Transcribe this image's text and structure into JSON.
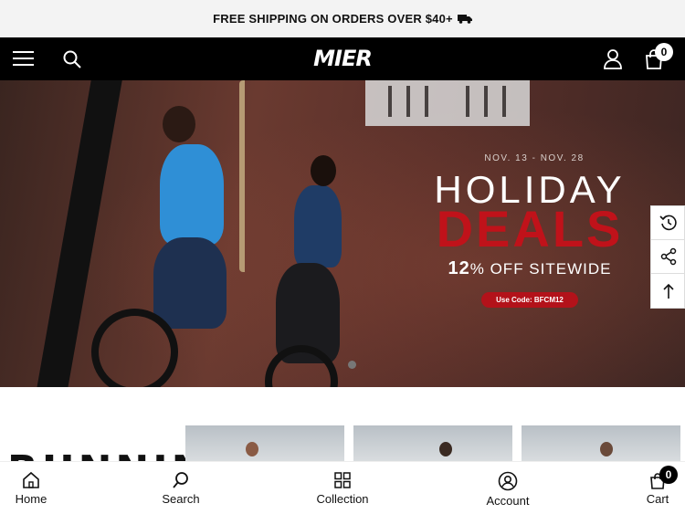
{
  "announcement": {
    "text": "FREE SHIPPING ON ORDERS OVER $40+",
    "icon": "truck-icon"
  },
  "header": {
    "logo": "MIER",
    "cart_count": "0",
    "icons": [
      "menu-icon",
      "search-icon",
      "user-icon",
      "cart-icon"
    ]
  },
  "hero": {
    "dates": "NOV. 13 - NOV. 28",
    "headline": "HOLIDAY",
    "subheadline": "DEALS",
    "offer_percent": "12",
    "offer_text": "% OFF SITEWIDE",
    "code": "Use Code: BFCM12"
  },
  "side_tools": [
    "recently-viewed-icon",
    "share-icon",
    "back-to-top-icon"
  ],
  "section": {
    "heading": "RUNNING"
  },
  "bottom_nav": {
    "items": [
      {
        "label": "Home",
        "icon": "home-icon"
      },
      {
        "label": "Search",
        "icon": "search-icon"
      },
      {
        "label": "Collection",
        "icon": "grid-icon"
      },
      {
        "label": "Account",
        "icon": "account-icon"
      },
      {
        "label": "Cart",
        "icon": "cart-icon"
      }
    ],
    "cart_count": "0"
  },
  "colors": {
    "accent": "#c0121a",
    "header_bg": "#000000",
    "announce_bg": "#f3f3f3"
  }
}
